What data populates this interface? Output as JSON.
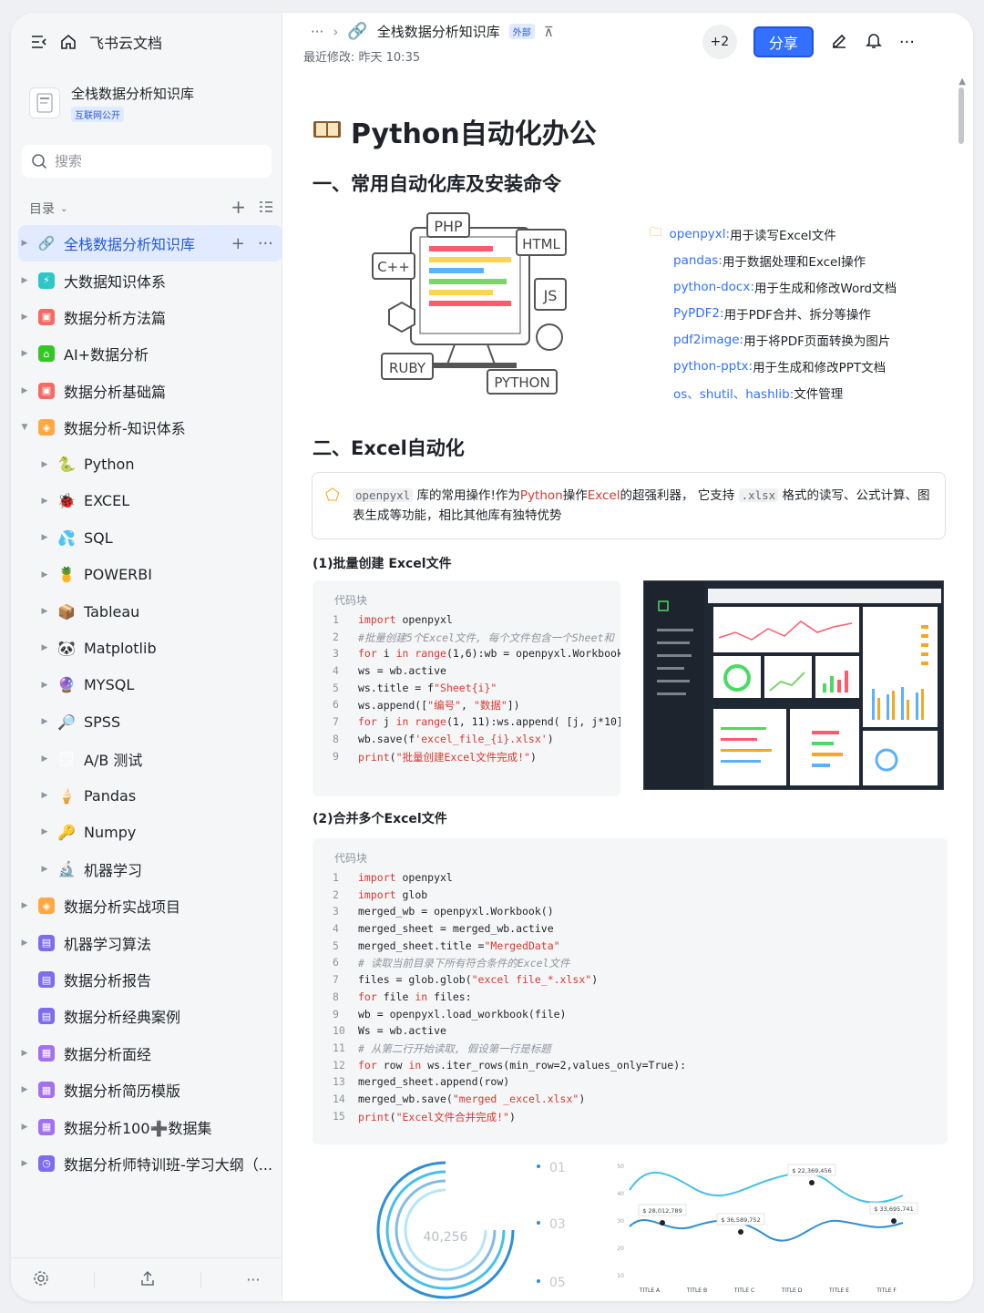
{
  "sidebar": {
    "app_name": "飞书云文档",
    "kb_title": "全栈数据分析知识库",
    "kb_badge": "互联网公开",
    "search_placeholder": "搜索",
    "toc_label": "目录",
    "items": [
      {
        "label": "全栈数据分析知识库",
        "color": "#3370ff"
      },
      {
        "label": "大数据知识体系",
        "color": "#2ec7c9"
      },
      {
        "label": "数据分析方法篇",
        "color": "#f76964"
      },
      {
        "label": "AI+数据分析",
        "color": "#34c724"
      },
      {
        "label": "数据分析基础篇",
        "color": "#f76964"
      },
      {
        "label": "数据分析-知识体系",
        "color": "#ffa940"
      },
      {
        "label": "Python",
        "emoji": "🐍"
      },
      {
        "label": "EXCEL",
        "emoji": "🐞"
      },
      {
        "label": "SQL",
        "emoji": "💦"
      },
      {
        "label": "POWERBI",
        "emoji": "🍍"
      },
      {
        "label": "Tableau",
        "emoji": "📦"
      },
      {
        "label": "Matplotlib",
        "emoji": "🐼"
      },
      {
        "label": "MYSQL",
        "emoji": "🔮"
      },
      {
        "label": "SPSS",
        "emoji": "🔎"
      },
      {
        "label": "A/B 测试",
        "emoji": "🗒"
      },
      {
        "label": "Pandas",
        "emoji": "🍦"
      },
      {
        "label": "Numpy",
        "emoji": "🔑"
      },
      {
        "label": "机器学习",
        "emoji": "🔬"
      },
      {
        "label": "数据分析实战项目",
        "color": "#ffa940"
      },
      {
        "label": "机器学习算法",
        "color": "#7f6bf0"
      },
      {
        "label": "数据分析报告",
        "color": "#7f6bf0"
      },
      {
        "label": "数据分析经典案例",
        "color": "#7f6bf0"
      },
      {
        "label": "数据分析面经",
        "color": "#a370f0"
      },
      {
        "label": "数据分析简历模版",
        "color": "#a370f0"
      },
      {
        "label": "数据分析100➕数据集",
        "color": "#a370f0"
      },
      {
        "label": "数据分析师特训班-学习大纲（...",
        "color": "#7f6bf0"
      }
    ]
  },
  "header": {
    "ellipsis": "···",
    "doc_title": "全栈数据分析知识库",
    "ext_badge": "外部",
    "modified": "最近修改: 昨天 10:35",
    "collaborators": "+2",
    "share_label": "分享"
  },
  "doc": {
    "title": "Python自动化办公",
    "section1": "一、常用自动化库及安装命令",
    "libs": [
      {
        "name": "openpyxl:",
        "desc": " 用于读写Excel文件"
      },
      {
        "name": "pandas:",
        "desc": " 用于数据处理和Excel操作"
      },
      {
        "name": "python-docx:",
        "desc": " 用于生成和修改Word文档"
      },
      {
        "name": "PyPDF2:",
        "desc": " 用于PDF合并、拆分等操作"
      },
      {
        "name": "pdf2image:",
        "desc": " 用于将PDF页面转换为图片"
      },
      {
        "name": "python-pptx:",
        "desc": "用于生成和修改PPT文档"
      },
      {
        "name": "os、shutil、hashlib:",
        "desc": " 文件管理"
      }
    ],
    "illustration_labels": [
      "PHP",
      "HTML",
      "C++",
      "JS",
      "RUBY",
      "PYTHON"
    ],
    "section2": "二、Excel自动化",
    "callout": {
      "code1": "openpyxl",
      "t1": " 库的常用操作!作为",
      "r1": "Python",
      "t2": "操作",
      "r2": "Excel",
      "t3": "的超强利器， 它支持 ",
      "code2": ".xlsx",
      "t4": " 格式的读写、公式计算、图表生成等功能，相比其他库有独特优势"
    },
    "sub1": "(1)批量创建 Excel文件",
    "code_label": "代码块",
    "code1": [
      "import openpyxl",
      "#批量创建5个Excel文件, 每个文件包含一个Sheet和",
      "for i in range(1,6):wb = openpyxl.Workbook",
      "ws = wb.active",
      "ws.title = f\"Sheet{i}\"",
      "ws.append([\"编号\", \"数据\"])",
      "for j in range(1, 11):ws.append( [j, j*10])",
      "wb.save(f'excel_file_{i}.xlsx')",
      "print(\"批量创建Excel文件完成!\")"
    ],
    "sub2": "(2)合并多个Excel文件",
    "code2": [
      "import openpyxl",
      "import glob",
      "merged_wb = openpyxl.Workbook()",
      "merged_sheet = merged_wb.active",
      "merged_sheet.title =\"MergedData\"",
      "# 读取当前目录下所有符合条件的Excel文件",
      "files = glob.glob(\"excel file_*.xlsx\")",
      "for file in files:",
      "wb = openpyxl.load_workbook(file)",
      "Ws = wb.active",
      "# 从第二行开始读取, 假设第一行是标题",
      "for row in ws.iter_rows(min_row=2,values_only=True):",
      "merged_sheet.append(row)",
      "merged_wb.save(\"merged _excel.xlsx\")",
      "print(\"Excel文件合并完成!\")"
    ],
    "infographic": {
      "center_value": "40,256",
      "steps": [
        "01",
        "03",
        "05"
      ],
      "line_labels": [
        "$ 22,369,456",
        "$ 28,012,789",
        "$ 36,589,752",
        "$ 33,695,741"
      ],
      "x_titles": [
        "TITLE A",
        "TITLE B",
        "TITLE C",
        "TITLE D",
        "TITLE E",
        "TITLE F"
      ],
      "y_ticks": [
        "50",
        "40",
        "30",
        "20",
        "10"
      ]
    }
  }
}
